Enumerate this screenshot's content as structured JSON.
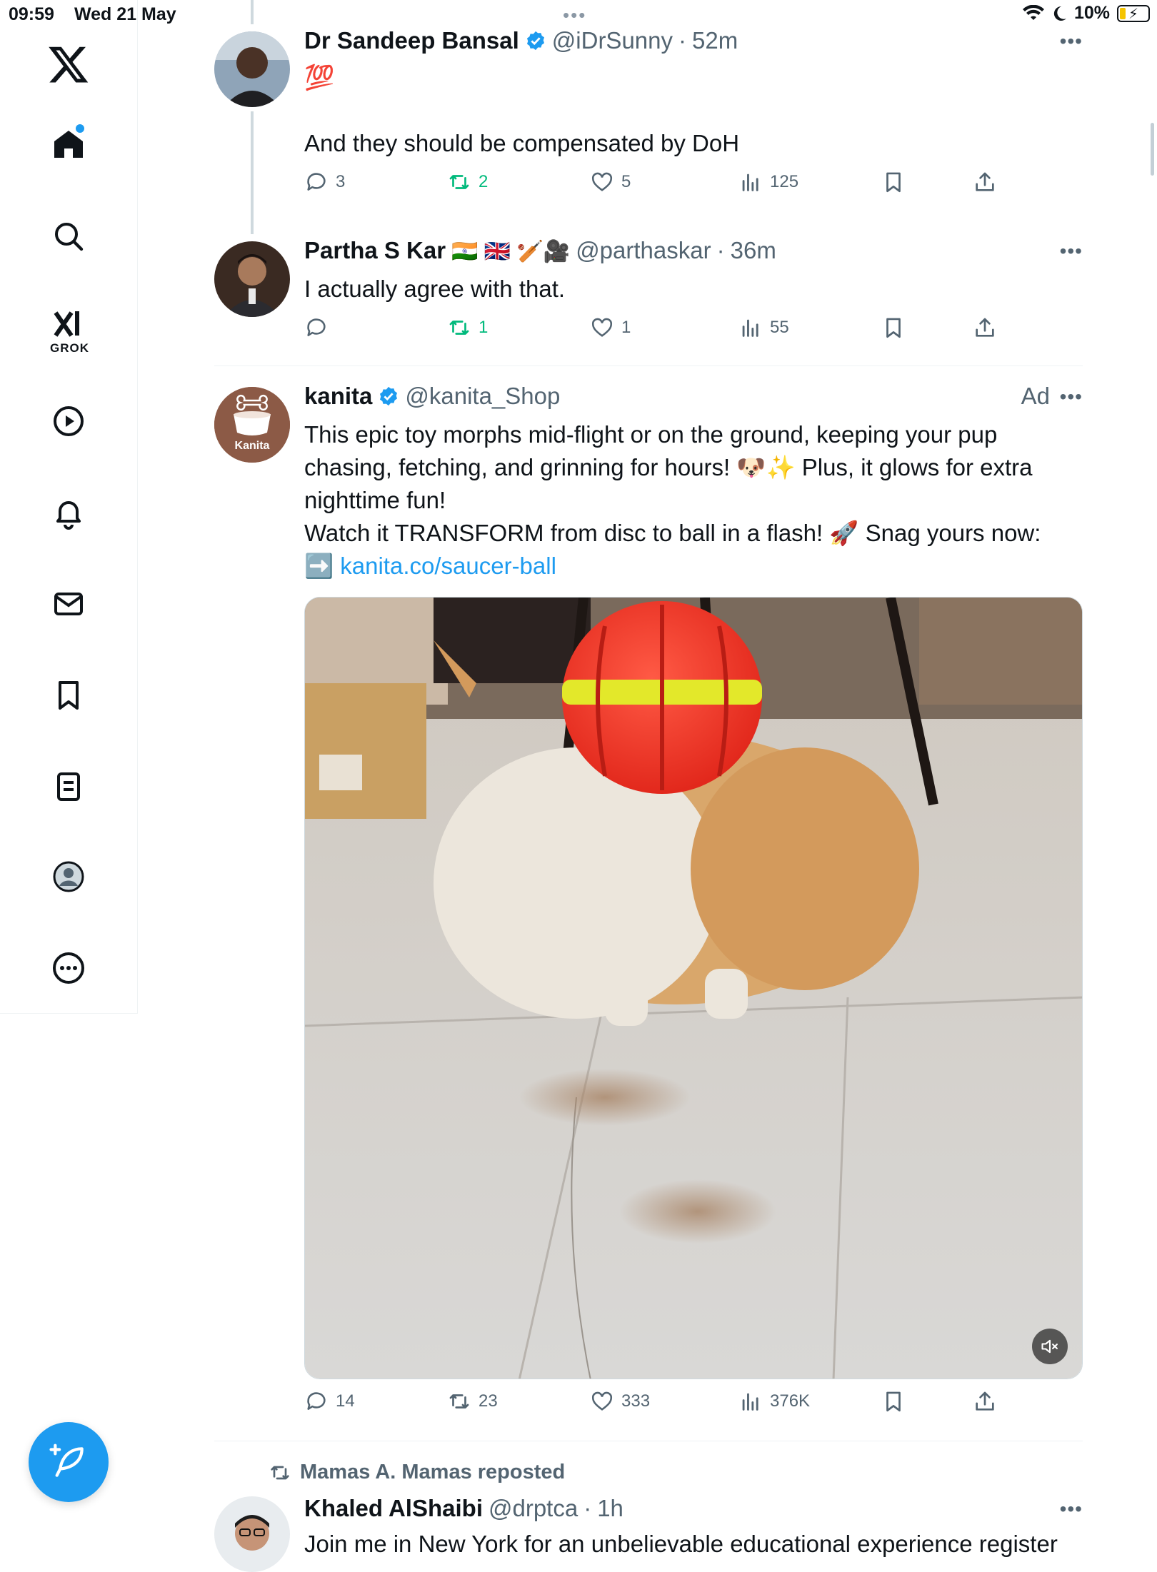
{
  "status_bar": {
    "time": "09:59",
    "date": "Wed 21 May",
    "battery": "10%",
    "dots": "•••"
  },
  "sidebar": {
    "grok_label": "GROK",
    "items": [
      {
        "icon": "x-logo-icon"
      },
      {
        "icon": "home-icon"
      },
      {
        "icon": "search-icon"
      },
      {
        "icon": "grok-icon"
      },
      {
        "icon": "video-icon"
      },
      {
        "icon": "notifications-icon"
      },
      {
        "icon": "messages-icon"
      },
      {
        "icon": "bookmarks-icon"
      },
      {
        "icon": "lists-icon"
      },
      {
        "icon": "profile-icon"
      },
      {
        "icon": "more-icon"
      }
    ]
  },
  "tweets": [
    {
      "name": "Dr Sandeep Bansal",
      "handle": "@iDrSunny",
      "sep": "·",
      "time": "52m",
      "emoji": "💯",
      "text": "And they should be compensated by DoH",
      "replies": "3",
      "reposts": "2",
      "likes": "5",
      "views": "125"
    },
    {
      "name": "Partha S Kar",
      "flags": "🇮🇳 🇬🇧 🏏🎥",
      "handle": "@parthaskar",
      "sep": "·",
      "time": "36m",
      "text": "I actually agree with that.",
      "replies": "",
      "reposts": "1",
      "likes": "1",
      "views": "55"
    },
    {
      "name": "kanita",
      "handle": "@kanita_Shop",
      "ad": "Ad",
      "avatar_label": "Kanita",
      "line1": "This epic toy morphs mid-flight or on the ground, keeping your pup",
      "line2": "chasing, fetching, and grinning for hours! 🐶✨ Plus, it glows for extra",
      "line3": "nighttime fun!",
      "line4": "Watch it TRANSFORM from disc to ball in a flash! 🚀 Snag yours now:",
      "line5_prefix": "➡️ ",
      "link": "kanita.co/saucer-ball",
      "replies": "14",
      "reposts": "23",
      "likes": "333",
      "views": "376K"
    },
    {
      "reposted_by": "Mamas A. Mamas reposted",
      "name": "Khaled AlShaibi",
      "handle": "@drptca",
      "sep": "·",
      "time": "1h",
      "text": "Join me in New York for an unbelievable educational experience register"
    }
  ],
  "colors": {
    "accent": "#1d9bf0",
    "repost_green": "#00ba7c",
    "secondary_text": "#536471"
  }
}
